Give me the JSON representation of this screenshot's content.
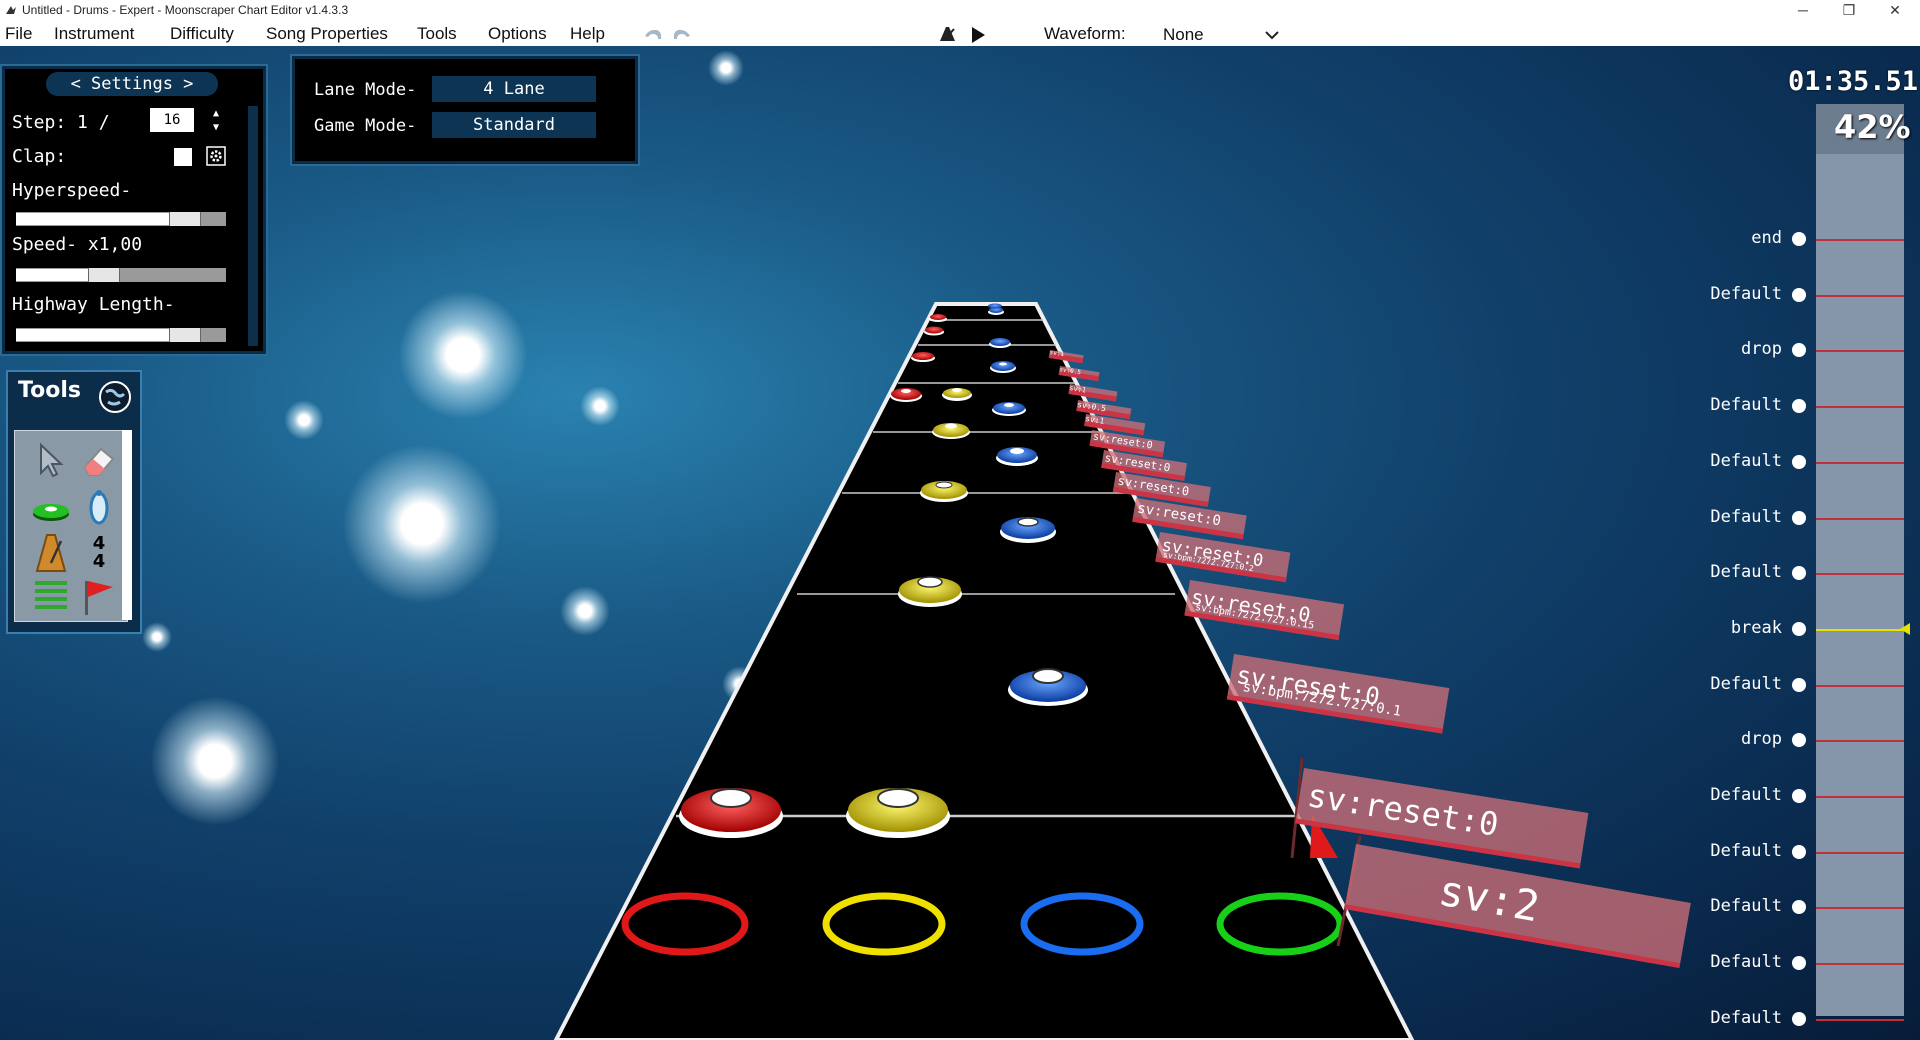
{
  "window": {
    "title": "Untitled - Drums - Expert - Moonscraper Chart Editor v1.4.3.3",
    "controls": [
      "─",
      "❐",
      "✕"
    ]
  },
  "menu": {
    "items": [
      "File",
      "Instrument",
      "Difficulty",
      "Song Properties",
      "Tools",
      "Options",
      "Help"
    ],
    "waveform_label": "Waveform:",
    "waveform_value": "None"
  },
  "settings": {
    "header": "< Settings >",
    "step_label": "Step: 1 /",
    "step_value": "16",
    "clap_label": "Clap:",
    "clap_checked": false,
    "hyperspeed_label": "Hyperspeed-",
    "hyperspeed_level": 0.85,
    "speed_label": "Speed- x1,00",
    "speed_level": 0.4,
    "highway_length_label": "Highway Length-",
    "highway_length_level": 0.85
  },
  "modes": {
    "lane_label": "Lane Mode-",
    "lane_value": "4 Lane",
    "game_label": "Game Mode-",
    "game_value": "Standard"
  },
  "tools": {
    "title": "Tools",
    "time_signature": [
      "4",
      "4"
    ]
  },
  "playback": {
    "time": "01:35.51",
    "percent": "42%",
    "progress_fraction": 0.42
  },
  "sections": [
    {
      "label": "end",
      "current": false
    },
    {
      "label": "Default",
      "current": false
    },
    {
      "label": "drop",
      "current": false
    },
    {
      "label": "Default",
      "current": false
    },
    {
      "label": "Default",
      "current": false
    },
    {
      "label": "Default",
      "current": false
    },
    {
      "label": "Default",
      "current": false
    },
    {
      "label": "break",
      "current": true
    },
    {
      "label": "Default",
      "current": false
    },
    {
      "label": "drop",
      "current": false
    },
    {
      "label": "Default",
      "current": false
    },
    {
      "label": "Default",
      "current": false
    },
    {
      "label": "Default",
      "current": false
    },
    {
      "label": "Default",
      "current": false
    },
    {
      "label": "Default",
      "current": false
    }
  ],
  "events": {
    "sv_2": "sv:2",
    "sv_reset_0": "sv:reset:0",
    "sv_bpm_01": "sv:bpm:7272.727:0.1",
    "sv_bpm_015": "sv:bpm:7272.727:0.15",
    "sv_bpm_02": "sv:bpm:7272.727:0.2",
    "sv_05": "sv:0.5",
    "sv_1": "sv:1"
  },
  "colors": {
    "red": "#e02020",
    "yellow": "#f0e000",
    "blue": "#1a6cf0",
    "green": "#20d020",
    "panel_border": "#2a6a96"
  }
}
